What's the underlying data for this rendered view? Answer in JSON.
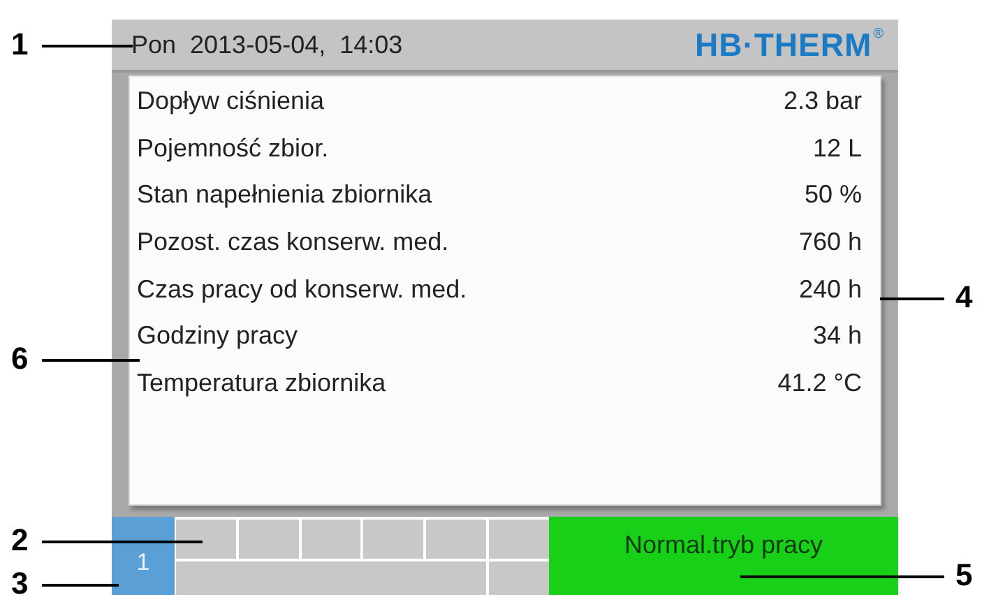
{
  "header": {
    "datetime": "Pon  2013-05-04,  14:03",
    "logo": "HB·THERM",
    "logo_mark": "®"
  },
  "rows": [
    {
      "label": "Dopływ ciśnienia",
      "value": "2.3 bar"
    },
    {
      "label": "Pojemność zbior.",
      "value": "12 L"
    },
    {
      "label": "Stan napełnienia zbiornika",
      "value": "50 %"
    },
    {
      "label": "Pozost. czas konserw. med.",
      "value": "760 h"
    },
    {
      "label": "Czas pracy od konserw. med.",
      "value": "240 h"
    },
    {
      "label": "Godziny pracy",
      "value": "34 h"
    },
    {
      "label": "Temperatura zbiornika",
      "value": "41.2 °C"
    }
  ],
  "status_bar": {
    "unit_number": "1",
    "mode": "Normal.tryb pracy"
  },
  "callouts": [
    {
      "label": "1",
      "kind": "left"
    },
    {
      "label": "6",
      "kind": "left"
    },
    {
      "label": "2",
      "kind": "left"
    },
    {
      "label": "3",
      "kind": "left"
    },
    {
      "label": "4",
      "kind": "right"
    },
    {
      "label": "5",
      "kind": "right"
    }
  ]
}
